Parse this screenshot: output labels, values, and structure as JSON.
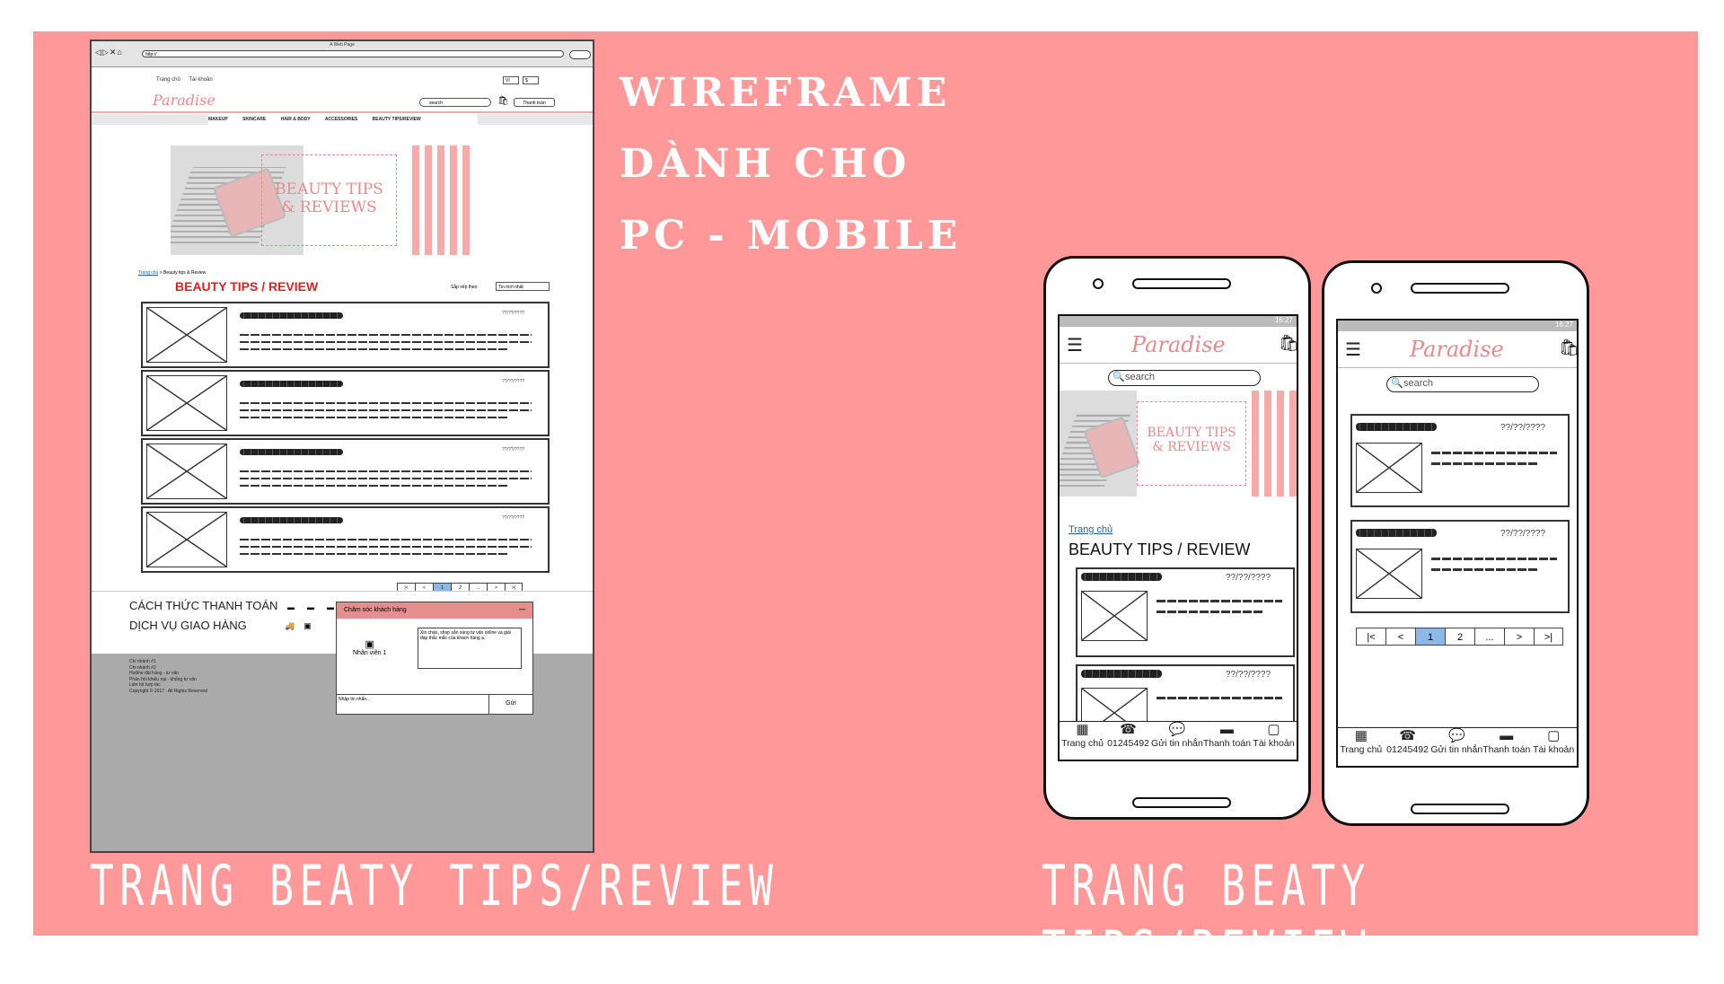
{
  "headings": [
    "WIREFRAME",
    "DÀNH CHO",
    "PC - MOBILE"
  ],
  "captions": {
    "left": "TRANG BEATY TIPS/REVIEW",
    "right": "TRANG BEATY TIPS/REVIEW"
  },
  "pc": {
    "browser_title": "A Web Page",
    "url": "http://",
    "top_links": [
      "Trang chủ",
      "Tài khoản"
    ],
    "select1": "VI",
    "select2": "$",
    "logo": "Paradise",
    "search_placeholder": "search",
    "pay_button": "Thanh toán",
    "menu": [
      "MAKEUP",
      "SKINCARE",
      "HAIR & BODY",
      "ACCESSORIES",
      "BEAUTY TIPS/REVIEW"
    ],
    "hero_text1": "BEAUTY TIPS",
    "hero_text2": "& REVIEWS",
    "breadcrumb_home": "Trang chủ",
    "breadcrumb_current": "Beauty tips & Review",
    "page_title": "BEAUTY TIPS / REVIEW",
    "sort_label": "Sắp xếp theo",
    "sort_value": "Tin mới nhất",
    "articles": [
      {
        "date": "??/??/????"
      },
      {
        "date": "??/??/????"
      },
      {
        "date": "??/??/????"
      },
      {
        "date": "??/??/????"
      }
    ],
    "pagination": [
      "|<",
      "<",
      "1",
      "2",
      "...",
      ">",
      ">|"
    ],
    "footer_payment": "CÁCH THỨC THANH TOÁN",
    "footer_shipping": "DỊCH VỤ GIAO HÀNG",
    "footer_links": [
      "Chi nhánh #1",
      "Chi nhánh #2",
      "Hotline đặt hàng - tư vấn",
      "Phản hồi khiếu nại - khống tư vấn",
      "Liên hệ hợp tác",
      "Copyright © 2017 . All Rights Reserved"
    ],
    "chat": {
      "header": "Chăm sóc khách hàng",
      "agent": "Nhân viên 1",
      "message": "Xin chào, shop sẵn sàng tư vấn online và giải đáp thắc mắc của khách hàng ạ.",
      "input_placeholder": "Nhập tin nhắn...",
      "send": "Gửi"
    }
  },
  "mobile": {
    "status_time": "16:27",
    "logo": "Paradise",
    "search_placeholder": "search",
    "breadcrumb_home": "Trang chủ",
    "page_title": "BEAUTY TIPS / REVIEW",
    "hero_text1": "BEAUTY TIPS",
    "hero_text2": "& REVIEWS",
    "article_date": "??/??/????",
    "pagination": [
      "|<",
      "<",
      "1",
      "2",
      "...",
      ">",
      ">|"
    ],
    "nav": [
      "Trang chủ",
      "01245492",
      "Gửi tin nhắn",
      "Thanh toán",
      "Tài khoản"
    ]
  }
}
